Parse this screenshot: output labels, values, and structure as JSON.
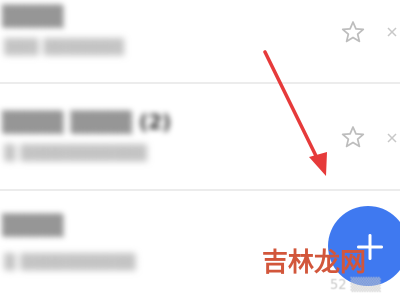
{
  "list": {
    "items": [
      {
        "title": "▒▒▒▒",
        "subtitle": "▒▒▒ ▒▒▒▒▒▒▒"
      },
      {
        "title": "▒▒▒▒ ▒▒▒▒ (2)",
        "subtitle": "▒ ▒▒▒▒▒▒▒▒▒▒▒"
      },
      {
        "title": "▒▒▒▒",
        "subtitle": "▒ ▒▒▒▒▒▒▒▒▒▒"
      }
    ]
  },
  "icons": {
    "star": "star-outline-icon",
    "more": "more-icon",
    "fab": "plus-icon",
    "annotation": "red-arrow"
  },
  "colors": {
    "fab": "#3f79f0",
    "arrow": "#e63a3a",
    "watermark": "#d2563b"
  },
  "watermark": {
    "text": "吉林龙网",
    "subtext": "52 ▒▒▒"
  }
}
